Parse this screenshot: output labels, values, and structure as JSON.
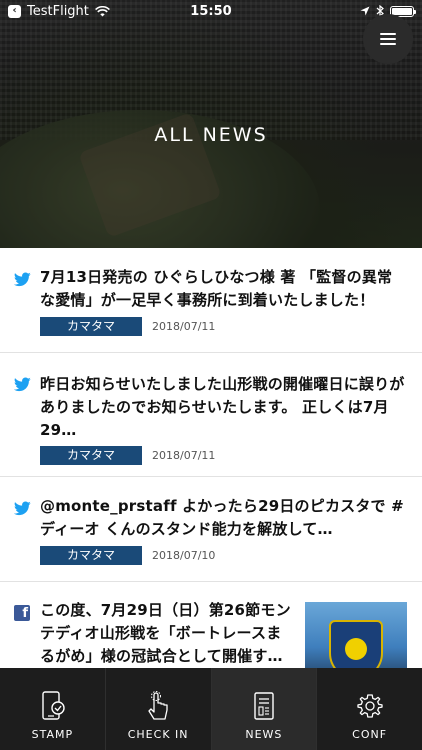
{
  "status_bar": {
    "back_app": "TestFlight",
    "time": "15:50"
  },
  "header": {
    "title": "ALL NEWS",
    "menu_icon": "hamburger-icon"
  },
  "news": [
    {
      "source_icon": "twitter-icon",
      "title": "7月13日発売の ひぐらしひなつ様 著 「監督の異常な愛情」が一足早く事務所に到着いたしました！ あ…",
      "tag": "カマタマ",
      "date": "2018/07/11"
    },
    {
      "source_icon": "twitter-icon",
      "title": "昨日お知らせいたしました山形戦の開催曜日に誤りがありましたのでお知らせいたします。 正しくは7月29…",
      "tag": "カマタマ",
      "date": "2018/07/11"
    },
    {
      "source_icon": "twitter-icon",
      "title": "@monte_prstaff よかったら29日のピカスタで #ディーオ くんのスタンド能力を解放して…",
      "tag": "カマタマ",
      "date": "2018/07/10"
    },
    {
      "source_icon": "facebook-icon",
      "title": "この度、7月29日（日）第26節モンテディオ山形戦を「ボートレースまるがめ」様の冠試合として開催す…"
    }
  ],
  "tabs": [
    {
      "label": "STAMP",
      "icon": "stamp-phone-icon"
    },
    {
      "label": "CHECK IN",
      "icon": "check-in-hand-icon"
    },
    {
      "label": "NEWS",
      "icon": "news-document-icon"
    },
    {
      "label": "CONF",
      "icon": "gear-icon"
    }
  ],
  "colors": {
    "tag_bg": "#1a4a78",
    "tab_bar_bg": "#1d1d1d",
    "twitter": "#1da1f2",
    "facebook": "#3b5998"
  }
}
